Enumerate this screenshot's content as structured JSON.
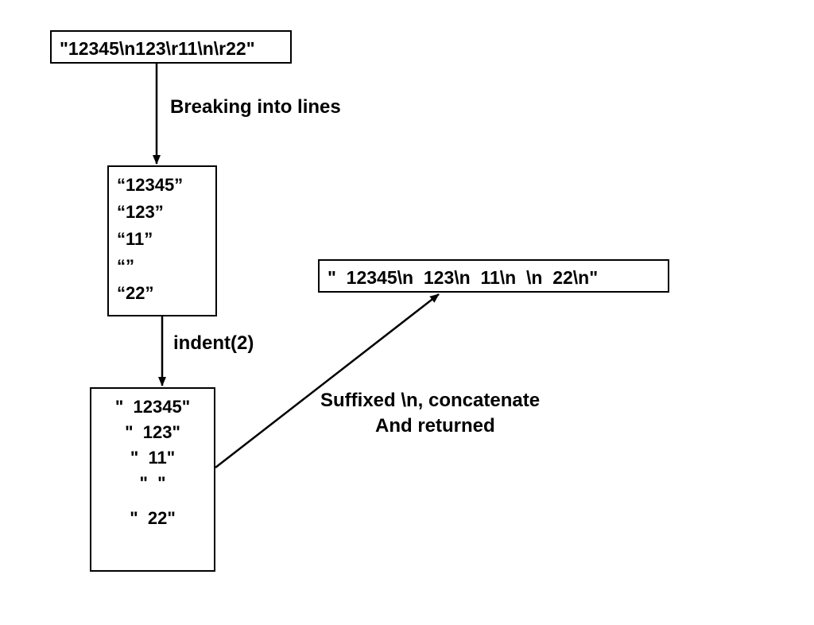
{
  "boxes": {
    "input": "\"12345\\n123\\r11\\n\\r22\"",
    "split_lines": [
      "“12345”",
      "“123”",
      "“11”",
      "“”",
      "“22”"
    ],
    "indented_lines": [
      "\"  12345\"",
      "\"  123\"",
      "\"  11\"",
      "\"  \"",
      "\"  22\""
    ],
    "output": "\"  12345\\n  123\\n  11\\n  \\n  22\\n\""
  },
  "labels": {
    "step1": "Breaking into lines",
    "step2": "indent(2)",
    "step3a": "Suffixed \\n, concatenate",
    "step3b": "And returned"
  }
}
